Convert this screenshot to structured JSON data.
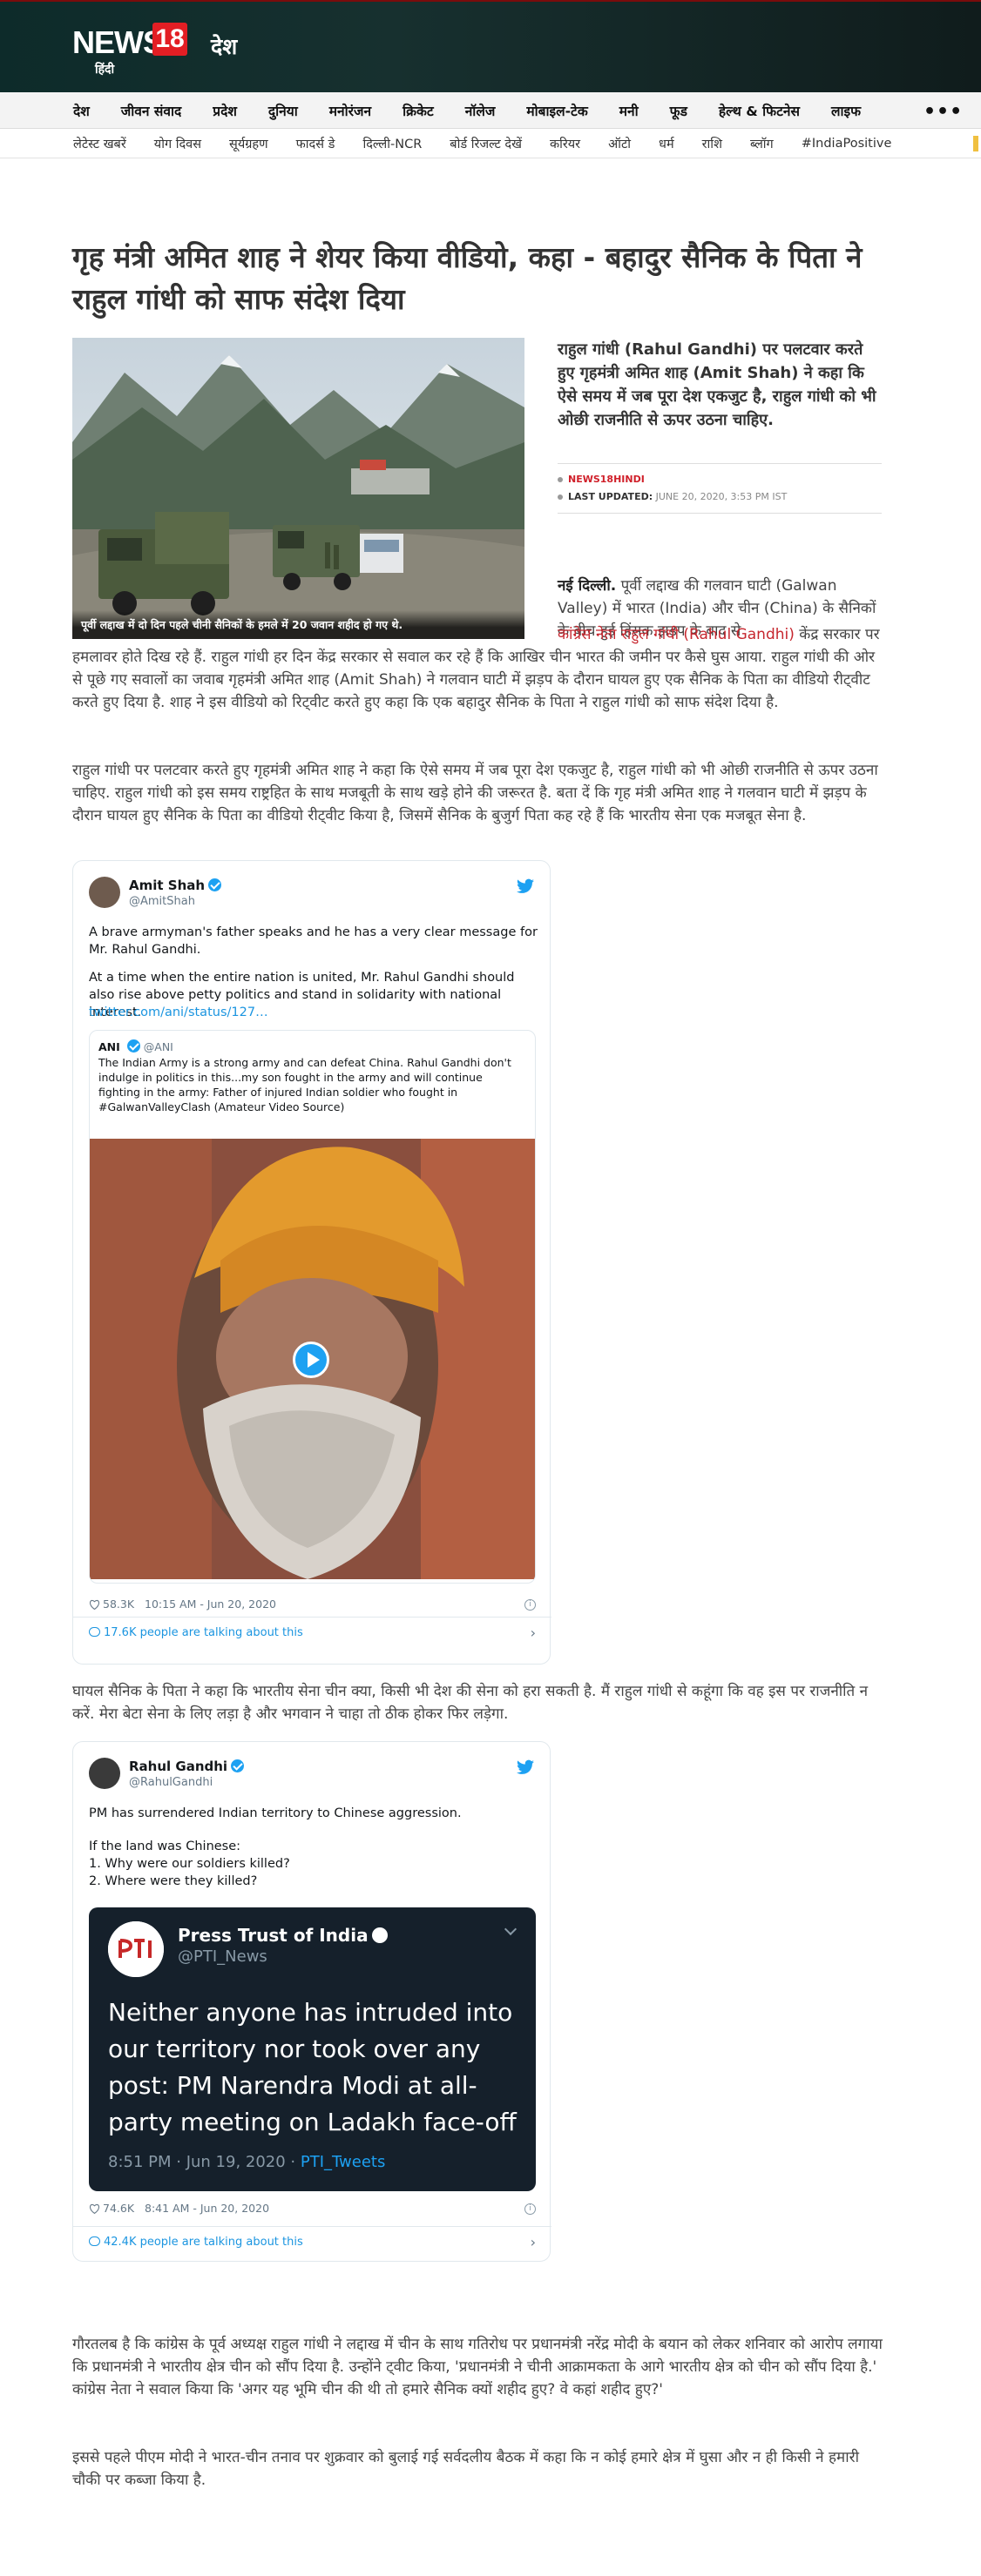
{
  "header": {
    "logo_text": "NEWS",
    "logo_number": "18",
    "logo_sub": "हिंदी",
    "section": "देश"
  },
  "nav_primary": [
    "देश",
    "जीवन संवाद",
    "प्रदेश",
    "दुनिया",
    "मनोरंजन",
    "क्रिकेट",
    "नॉलेज",
    "मोबाइल-टेक",
    "मनी",
    "फूड",
    "हेल्थ & फिटनेस",
    "लाइफ"
  ],
  "nav_more": "•••",
  "nav_secondary": [
    "लेटेस्ट खबरें",
    "योग दिवस",
    "सूर्यग्रहण",
    "फादर्स डे",
    "दिल्ली-NCR",
    "बोर्ड रिजल्ट देखें",
    "करियर",
    "ऑटो",
    "धर्म",
    "राशि",
    "ब्लॉग",
    "#IndiaPositive"
  ],
  "article": {
    "headline": "गृह मंत्री अमित शाह ने शेयर किया वीडियो, कहा - बहादुर सैनिक के पिता ने राहुल गांधी को साफ संदेश दिया",
    "image_caption": "पूर्वी लद्दाख में दो दिन पहले चीनी सैनिकों के हमले में 20 जवान शहीद हो गए थे.",
    "summary": "राहुल गांधी (Rahul Gandhi) पर पलटवार करते हुए गृहमंत्री अमित शाह (Amit Shah) ने कहा कि ऐसे समय में जब पूरा देश एकजुट है, राहुल गांधी को भी ओछी राजनीति से ऊपर उठना चाहिए.",
    "source": "NEWS18HINDI",
    "updated_label": "LAST UPDATED:",
    "updated_value": "JUNE 20, 2020, 3:53 PM IST",
    "para1": {
      "lead": "नई दिल्ली.",
      "a": " पूर्वी लद्दाख की गलवान घाटी (Galwan Valley) में भारत (India) और चीन (China) के सैनिकों के बीच हुई हिंसक झड़प के बाद से ",
      "link": "कांग्रेस नेता राहुल गांधी (Rahul Gandhi)",
      "b": " केंद्र सरकार पर हमलावर होते दिख रहे हैं. राहुल गांधी हर दिन केंद्र सरकार से सवाल कर रहे हैं कि आखिर चीन भारत की जमीन पर कैसे घुस आया. राहुल गांधी की ओर से पूछे गए सवालों का जवाब गृहमंत्री अमित शाह (Amit Shah) ने गलवान घाटी में झड़प के दौरान घायल हुए एक सैनिक के पिता का वीडियो रीट्वीट करते हुए दिया है. शाह ने इस वीडियो को रिट्वीट करते हुए कहा कि एक बहादुर सैनिक के पिता ने राहुल गांधी को साफ संदेश दिया है."
    },
    "para2": "राहुल गांधी पर पलटवार करते हुए गृहमंत्री अमित शाह ने कहा कि ऐसे समय में जब पूरा देश एकजुट है, राहुल गांधी को भी ओछी राजनीति से ऊपर उठना चाहिए. राहुल गांधी को इस समय राष्ट्रहित के साथ मजबूती के साथ खड़े होने की जरूरत है. बता दें कि गृह मंत्री अमित शाह ने गलवान घाटी में झड़प के दौरान घायल हुए सैनिक के पिता का वीडियो रीट्वीट किया है, जिसमें सैनिक के बुजुर्ग पिता कह रहे हैं कि भारतीय सेना एक मजबूत सेना है.",
    "para3": "घायल सैनिक के पिता ने कहा कि भारतीय सेना चीन क्या, किसी भी देश की सेना को हरा सकती है. मैं राहुल गांधी से कहूंगा कि वह इस पर राजनीति न करें. मेरा बेटा सेना के लिए लड़ा है और भगवान ने चाहा तो ठीक होकर फिर लड़ेगा.",
    "para4": "गौरतलब है कि कांग्रेस के पूर्व अध्यक्ष राहुल गांधी ने लद्दाख में चीन के साथ गतिरोध पर प्रधानमंत्री नरेंद्र मोदी के बयान को लेकर शनिवार को आरोप लगाया कि प्रधानमंत्री ने भारतीय क्षेत्र चीन को सौंप दिया है. उन्होंने ट्वीट किया, 'प्रधानमंत्री ने चीनी आक्रामकता के आगे भारतीय क्षेत्र को चीन को सौंप दिया है.' कांग्रेस नेता ने सवाल किया कि 'अगर यह भूमि चीन की थी तो हमारे सैनिक क्यों शहीद हुए? वे कहां शहीद हुए?'",
    "para5": "इससे पहले पीएम मोदी ने भारत-चीन तनाव पर शुक्रवार को बुलाई गई सर्वदलीय बैठक में कहा कि न कोई हमारे क्षेत्र में घुसा और न ही किसी ने हमारी चौकी पर कब्जा किया है."
  },
  "tweet1": {
    "name": "Amit Shah",
    "handle": "@AmitShah",
    "text1": "A brave armyman's father speaks and he has a very clear message for Mr. Rahul Gandhi.",
    "text2": "At a time when the entire nation is united, Mr. Rahul Gandhi should also rise above petty politics and stand in solidarity with national interest.",
    "link": "twitter.com/ani/status/127…",
    "quote_name": "ANI",
    "quote_handle": "@ANI",
    "quote_text": "The Indian Army is a strong army and can defeat China. Rahul Gandhi don't indulge in politics in this...my son fought in the army and will continue fighting in the army: Father of injured Indian soldier who fought in #GalwanValleyClash (Amateur Video Source)",
    "likes": "58.3K",
    "time": "10:15 AM - Jun 20, 2020",
    "talking": "17.6K people are talking about this"
  },
  "tweet2": {
    "name": "Rahul Gandhi",
    "handle": "@RahulGandhi",
    "text1": "PM has surrendered Indian territory to Chinese aggression.",
    "text2": "If the land was Chinese:",
    "text3": "1. Why were our soldiers killed?",
    "text4": "2. Where were they killed?",
    "embed_name": "Press Trust of India",
    "embed_handle": "@PTI_News",
    "embed_text": "Neither anyone has intruded into our territory nor took over any post: PM Narendra Modi at all-party meeting on Ladakh face-off",
    "embed_time": "8:51 PM · Jun 19, 2020 · ",
    "embed_source": "PTI_Tweets",
    "likes": "74.6K",
    "time": "8:41 AM - Jun 20, 2020",
    "talking": "42.4K people are talking about this"
  },
  "colors": {
    "accent_red": "#c6262e",
    "twitter_blue": "#1da1f2",
    "header_bg": "#0d2b2a"
  }
}
